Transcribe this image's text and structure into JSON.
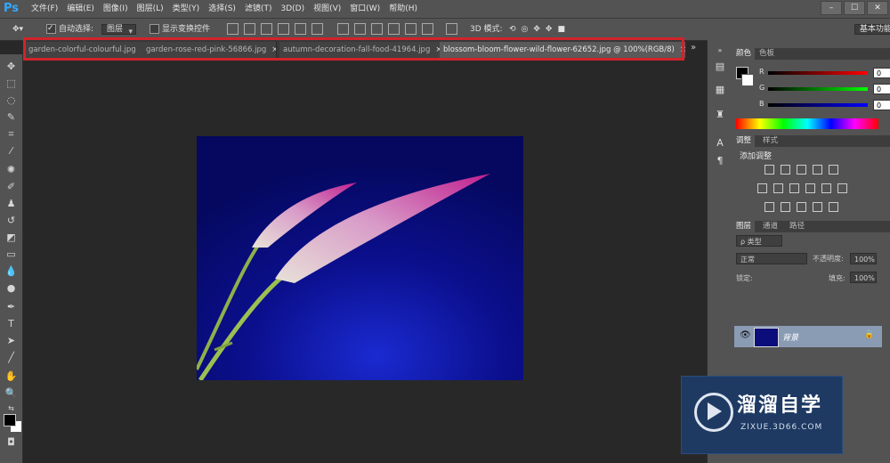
{
  "app": {
    "logo": "Ps"
  },
  "menu": [
    "文件(F)",
    "编辑(E)",
    "图像(I)",
    "图层(L)",
    "类型(Y)",
    "选择(S)",
    "滤镜(T)",
    "3D(D)",
    "视图(V)",
    "窗口(W)",
    "帮助(H)"
  ],
  "window_controls": [
    "–",
    "☐",
    "✕"
  ],
  "options": {
    "auto_select_label": "自动选择:",
    "auto_select_value": "图层",
    "show_transform_label": "显示变换控件",
    "mode_3d_label": "3D 模式:",
    "workspace_value": "基本功能"
  },
  "tabs": [
    {
      "label": "garden-colorful-colourful.jpg",
      "close": "×"
    },
    {
      "label": "garden-rose-red-pink-56866.jpg",
      "close": "×"
    },
    {
      "label": "autumn-decoration-fall-food-41964.jpg",
      "close": "×"
    },
    {
      "label": "blossom-bloom-flower-wild-flower-62652.jpg @ 100%(RGB/8)",
      "close": "×"
    }
  ],
  "tab_overflow": "»",
  "color_panel": {
    "tabs": [
      "颜色",
      "色板"
    ],
    "channels": [
      {
        "label": "R",
        "value": "0"
      },
      {
        "label": "G",
        "value": "0"
      },
      {
        "label": "B",
        "value": "0"
      }
    ]
  },
  "adjust_panel": {
    "tabs": [
      "调整",
      "样式"
    ],
    "heading": "添加调整"
  },
  "layers_panel": {
    "tabs": [
      "图层",
      "通道",
      "路径"
    ],
    "filter_label": "ρ 类型",
    "blend_mode": "正常",
    "opacity_label": "不透明度:",
    "opacity_value": "100%",
    "lock_label": "锁定:",
    "fill_label": "填充:",
    "fill_value": "100%",
    "layer_name": "背景"
  },
  "watermark": {
    "title": "溜溜自学",
    "url": "ZIXUE.3D66.COM"
  },
  "colors": {
    "menubar": "#535353",
    "canvas_bg": "#282828",
    "tab_highlight": "#d2232a",
    "image_bg": "#0b0e7a",
    "watermark_bg": "#1e3a63"
  }
}
